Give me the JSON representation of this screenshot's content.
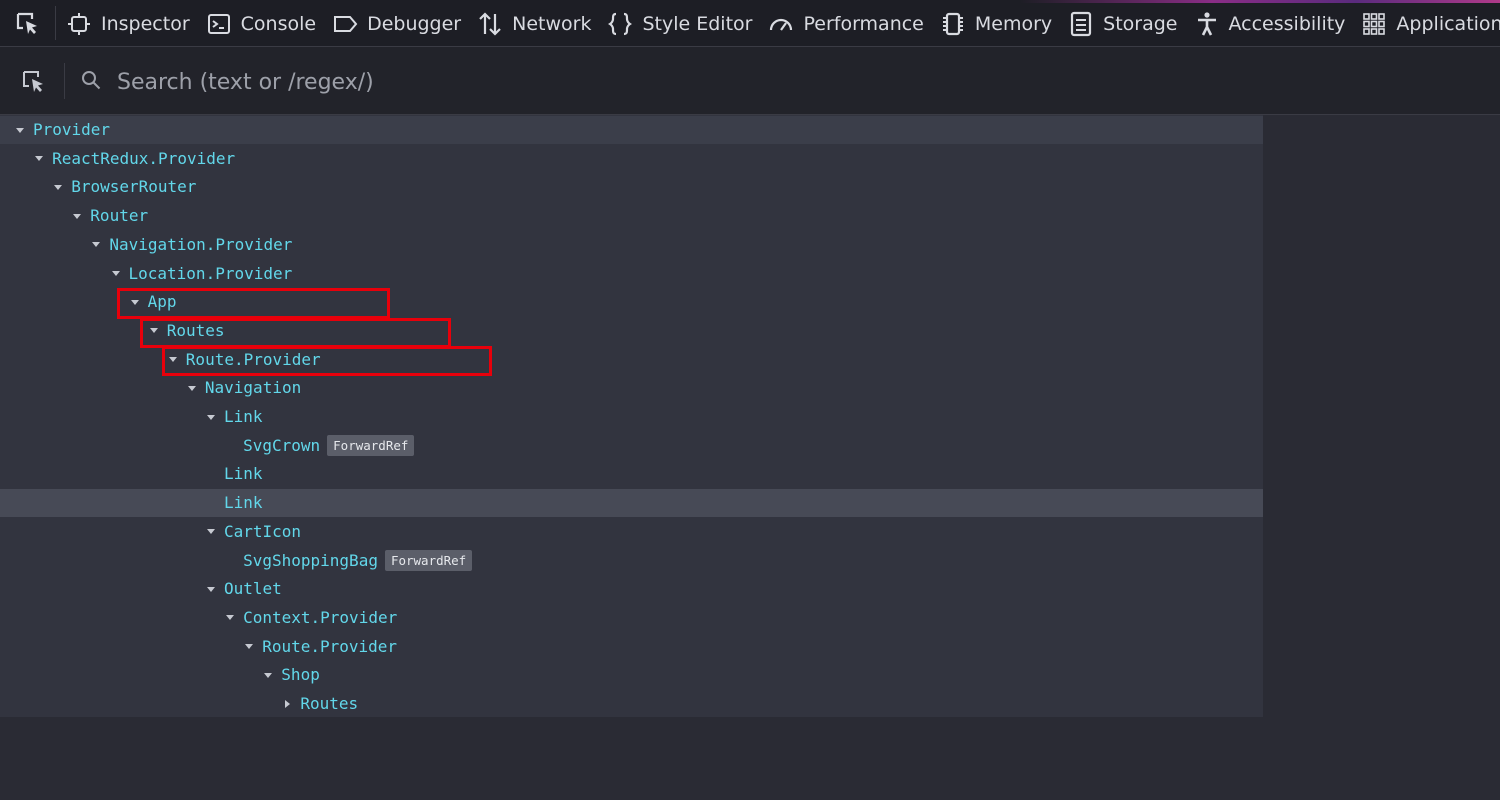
{
  "toolbar": {
    "tabs": [
      {
        "label": "Inspector",
        "icon": "inspector-icon"
      },
      {
        "label": "Console",
        "icon": "console-icon"
      },
      {
        "label": "Debugger",
        "icon": "debugger-icon"
      },
      {
        "label": "Network",
        "icon": "network-icon"
      },
      {
        "label": "Style Editor",
        "icon": "style-editor-icon"
      },
      {
        "label": "Performance",
        "icon": "performance-icon"
      },
      {
        "label": "Memory",
        "icon": "memory-icon"
      },
      {
        "label": "Storage",
        "icon": "storage-icon"
      },
      {
        "label": "Accessibility",
        "icon": "accessibility-icon"
      },
      {
        "label": "Application",
        "icon": "application-icon"
      }
    ]
  },
  "search": {
    "placeholder": "Search (text or /regex/)",
    "value": ""
  },
  "tree": {
    "rows": [
      {
        "label": "Provider",
        "depth": 0,
        "expanded": true
      },
      {
        "label": "ReactRedux.Provider",
        "depth": 1,
        "expanded": true
      },
      {
        "label": "BrowserRouter",
        "depth": 2,
        "expanded": true
      },
      {
        "label": "Router",
        "depth": 3,
        "expanded": true
      },
      {
        "label": "Navigation.Provider",
        "depth": 4,
        "expanded": true
      },
      {
        "label": "Location.Provider",
        "depth": 5,
        "expanded": true
      },
      {
        "label": "App",
        "depth": 6,
        "expanded": true
      },
      {
        "label": "Routes",
        "depth": 7,
        "expanded": true
      },
      {
        "label": "Route.Provider",
        "depth": 8,
        "expanded": true
      },
      {
        "label": "Navigation",
        "depth": 9,
        "expanded": true
      },
      {
        "label": "Link",
        "depth": 10,
        "expanded": true
      },
      {
        "label": "SvgCrown",
        "depth": 11,
        "badge": "ForwardRef"
      },
      {
        "label": "Link",
        "depth": 10
      },
      {
        "label": "Link",
        "depth": 10,
        "selected": true
      },
      {
        "label": "CartIcon",
        "depth": 10,
        "expanded": true
      },
      {
        "label": "SvgShoppingBag",
        "depth": 11,
        "badge": "ForwardRef"
      },
      {
        "label": "Outlet",
        "depth": 10,
        "expanded": true
      },
      {
        "label": "Context.Provider",
        "depth": 11,
        "expanded": true
      },
      {
        "label": "Route.Provider",
        "depth": 12,
        "expanded": true
      },
      {
        "label": "Shop",
        "depth": 13,
        "expanded": true
      },
      {
        "label": "Routes",
        "depth": 14,
        "expanded": false
      }
    ]
  },
  "annotations": {
    "highlight_color": "#e8000b",
    "highlighted_rows": [
      "App",
      "Routes",
      "Route.Provider"
    ]
  }
}
